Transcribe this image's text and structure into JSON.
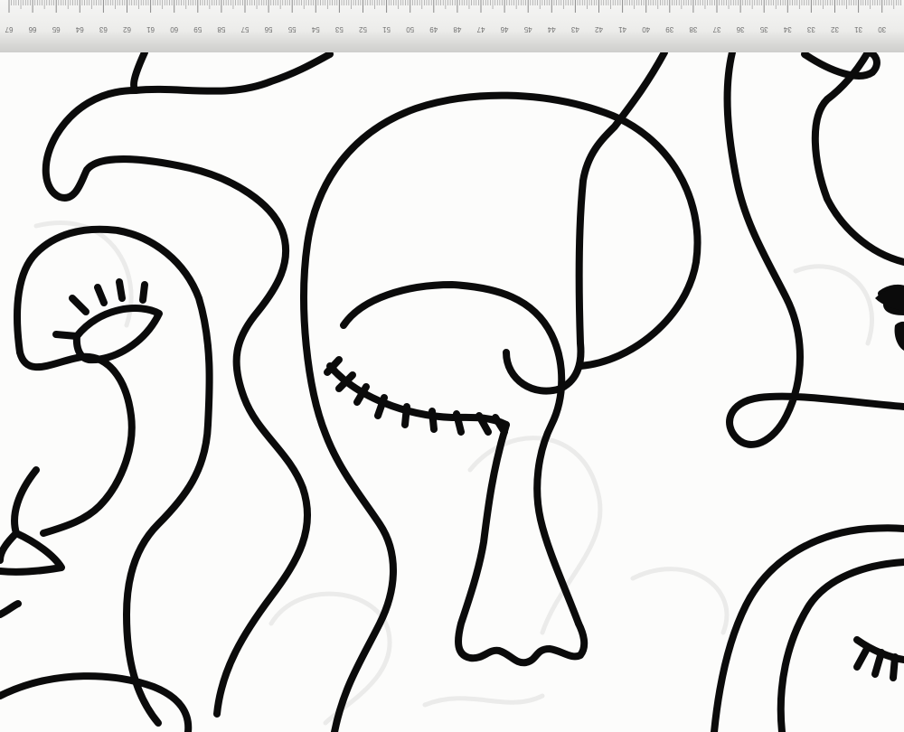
{
  "ruler": {
    "labels": [
      "67",
      "66",
      "65",
      "64",
      "63",
      "62",
      "61",
      "60",
      "59",
      "58",
      "57",
      "56",
      "55",
      "54",
      "53",
      "52",
      "51",
      "50",
      "49",
      "48",
      "47",
      "46",
      "45",
      "44",
      "43",
      "42",
      "41",
      "40",
      "39",
      "38",
      "37",
      "36",
      "35",
      "34",
      "33",
      "32",
      "31",
      "30",
      "29"
    ]
  },
  "colors": {
    "ink": "#0b0b0b",
    "fabric": "#fcfcfb",
    "ghost_print": "#ebebea",
    "ruler_text": "#6f6f6f"
  },
  "artwork": {
    "subject": "continuous line-art faces printed on white fabric",
    "figures": [
      "left-face-open-eye",
      "center-face-closed-eye",
      "right-face-partial",
      "bottom-right-face-closed-eye"
    ]
  }
}
